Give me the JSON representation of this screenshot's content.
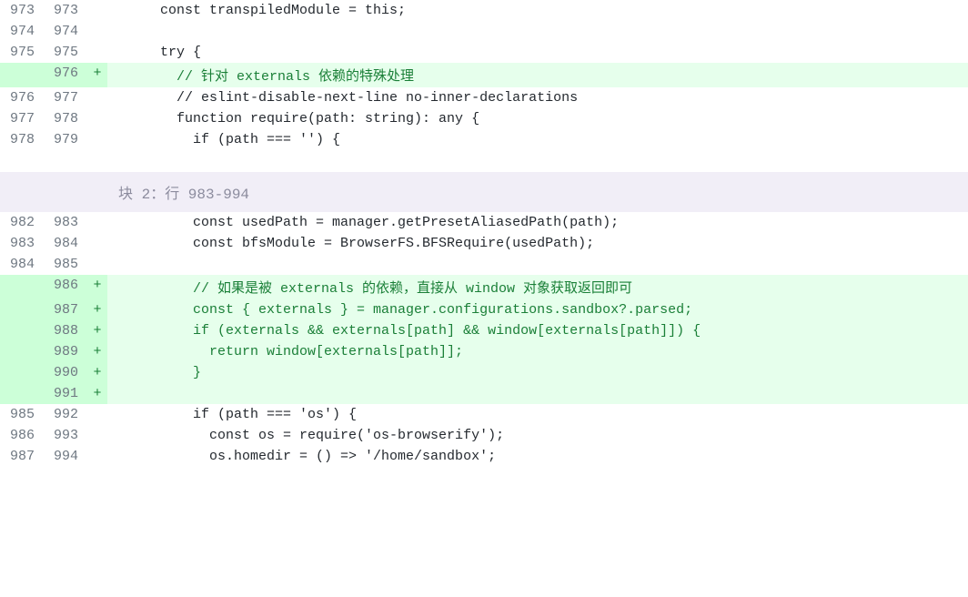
{
  "hunk2_label": "块 2：行 983-994",
  "rows": [
    {
      "old": "973",
      "new": "973",
      "type": "context",
      "marker": "",
      "code": "      const transpiledModule = this;"
    },
    {
      "old": "974",
      "new": "974",
      "type": "context",
      "marker": "",
      "code": ""
    },
    {
      "old": "975",
      "new": "975",
      "type": "context",
      "marker": "",
      "code": "      try {"
    },
    {
      "old": "",
      "new": "976",
      "type": "added",
      "marker": "+",
      "code": "        // 针对 externals 依赖的特殊处理"
    },
    {
      "old": "976",
      "new": "977",
      "type": "context",
      "marker": "",
      "code": "        // eslint-disable-next-line no-inner-declarations"
    },
    {
      "old": "977",
      "new": "978",
      "type": "context",
      "marker": "",
      "code": "        function require(path: string): any {"
    },
    {
      "old": "978",
      "new": "979",
      "type": "context",
      "marker": "",
      "code": "          if (path === '') {"
    }
  ],
  "rows2": [
    {
      "old": "982",
      "new": "983",
      "type": "context",
      "marker": "",
      "code": "          const usedPath = manager.getPresetAliasedPath(path);"
    },
    {
      "old": "983",
      "new": "984",
      "type": "context",
      "marker": "",
      "code": "          const bfsModule = BrowserFS.BFSRequire(usedPath);"
    },
    {
      "old": "984",
      "new": "985",
      "type": "context",
      "marker": "",
      "code": ""
    },
    {
      "old": "",
      "new": "986",
      "type": "added",
      "marker": "+",
      "code": "          // 如果是被 externals 的依赖，直接从 window 对象获取返回即可"
    },
    {
      "old": "",
      "new": "987",
      "type": "added",
      "marker": "+",
      "code": "          const { externals } = manager.configurations.sandbox?.parsed;"
    },
    {
      "old": "",
      "new": "988",
      "type": "added",
      "marker": "+",
      "code": "          if (externals && externals[path] && window[externals[path]]) {"
    },
    {
      "old": "",
      "new": "989",
      "type": "added",
      "marker": "+",
      "code": "            return window[externals[path]];"
    },
    {
      "old": "",
      "new": "990",
      "type": "added",
      "marker": "+",
      "code": "          }"
    },
    {
      "old": "",
      "new": "991",
      "type": "added",
      "marker": "+",
      "code": ""
    },
    {
      "old": "985",
      "new": "992",
      "type": "context",
      "marker": "",
      "code": "          if (path === 'os') {"
    },
    {
      "old": "986",
      "new": "993",
      "type": "context",
      "marker": "",
      "code": "            const os = require('os-browserify');"
    },
    {
      "old": "987",
      "new": "994",
      "type": "context",
      "marker": "",
      "code": "            os.homedir = () => '/home/sandbox';"
    }
  ]
}
